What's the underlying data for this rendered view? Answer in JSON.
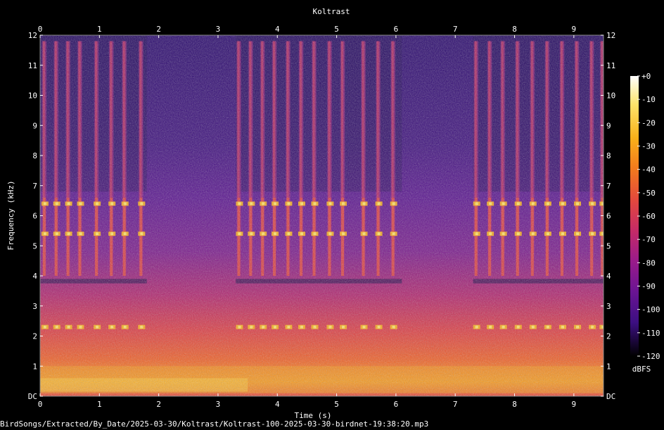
{
  "chart_data": {
    "type": "heatmap",
    "title": "Koltrast",
    "xlabel": "Time (s)",
    "ylabel": "Frequency (kHz)",
    "xlim": [
      0,
      9.5
    ],
    "ylim": [
      0,
      12
    ],
    "x_ticks": [
      "0",
      "1",
      "2",
      "3",
      "4",
      "5",
      "6",
      "7",
      "8",
      "9"
    ],
    "y_ticks": [
      "DC",
      "1",
      "2",
      "3",
      "4",
      "5",
      "6",
      "7",
      "8",
      "9",
      "10",
      "11",
      "12"
    ],
    "colorbar": {
      "label": "dBFS",
      "range": [
        -120,
        0
      ],
      "ticks": [
        "+0",
        "-10",
        "-20",
        "-30",
        "-40",
        "-50",
        "-60",
        "-70",
        "-80",
        "-90",
        "-100",
        "-110",
        "-120"
      ]
    },
    "colormap": [
      "#000000",
      "#1a0a4a",
      "#3c0f82",
      "#6a1493",
      "#9a1b8a",
      "#c62b66",
      "#e4493c",
      "#f27a1d",
      "#f9b11a",
      "#fde46c",
      "#ffffff"
    ],
    "song_phrases": [
      {
        "start": 0.0,
        "end": 1.8,
        "bands_khz": [
          2.3,
          5.4,
          6.4
        ]
      },
      {
        "start": 3.3,
        "end": 6.1,
        "bands_khz": [
          2.3,
          5.4,
          6.4
        ]
      },
      {
        "start": 7.3,
        "end": 9.5,
        "bands_khz": [
          2.3,
          5.4,
          6.4
        ]
      }
    ],
    "syllable_times": [
      0.07,
      0.27,
      0.47,
      0.67,
      0.95,
      1.2,
      1.42,
      1.7,
      3.35,
      3.55,
      3.75,
      3.95,
      4.18,
      4.4,
      4.62,
      4.88,
      5.1,
      5.45,
      5.7,
      5.95,
      7.35,
      7.58,
      7.8,
      8.05,
      8.3,
      8.55,
      8.8,
      9.05,
      9.3,
      9.48
    ]
  },
  "footer": "BirdSongs/Extracted/By_Date/2025-03-30/Koltrast/Koltrast-100-2025-03-30-birdnet-19:38:20.mp3"
}
